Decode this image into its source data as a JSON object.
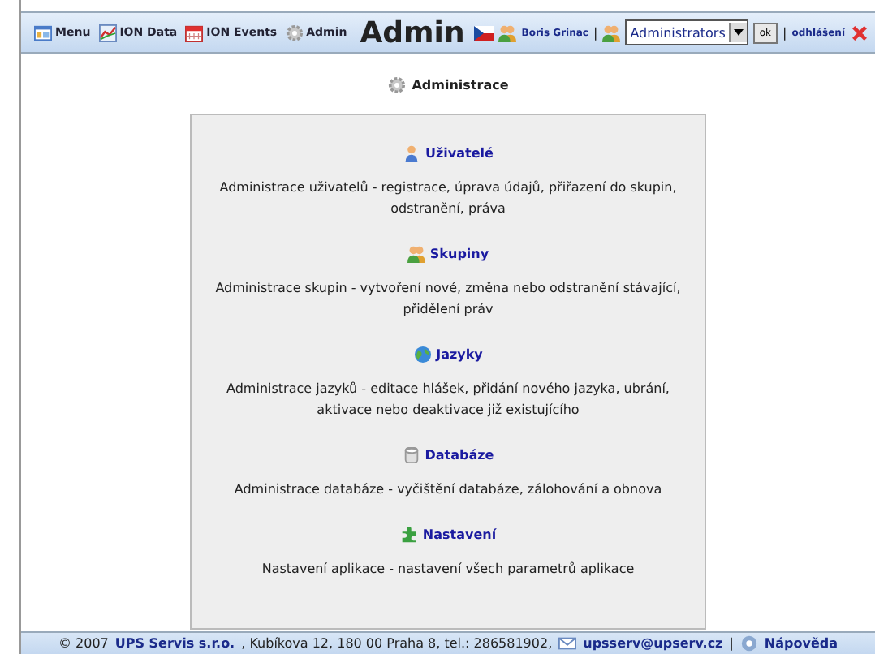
{
  "toolbar": {
    "nav": [
      {
        "kind": "menu",
        "label": "Menu"
      },
      {
        "kind": "data",
        "label": "ION Data"
      },
      {
        "kind": "events",
        "label": "ION Events"
      },
      {
        "kind": "admin",
        "label": "Admin"
      }
    ],
    "title": "Admin",
    "user": "Boris Grinac",
    "separator": "|",
    "role_select": {
      "value": "Administrators"
    },
    "ok_button": "ok",
    "separator_2": "|",
    "logout": "odhlášení"
  },
  "heading": "Administrace",
  "sections": [
    {
      "kind": "users",
      "title": "Uživatelé",
      "description": "Administrace uživatelů - registrace, úprava údajů, přiřazení do skupin, odstranění, práva"
    },
    {
      "kind": "groups",
      "title": "Skupiny",
      "description": "Administrace skupin - vytvoření nové, změna nebo odstranění stávající, přidělení práv"
    },
    {
      "kind": "languages",
      "title": "Jazyky",
      "description": "Administrace jazyků - editace hlášek, přidání nového jazyka, ubrání, aktivace nebo deaktivace již existujícího"
    },
    {
      "kind": "database",
      "title": "Databáze",
      "description": "Administrace databáze - vyčištění databáze, zálohování a obnova"
    },
    {
      "kind": "settings",
      "title": "Nastavení",
      "description": "Nastavení aplikace - nastavení všech parametrů aplikace"
    }
  ],
  "footer": {
    "copyright": "© 2007",
    "company": "UPS Servis s.r.o.",
    "address": ", Kubíkova 12, 180 00 Praha 8, tel.: 286581902,",
    "email": "upsserv@upserv.cz",
    "separator": "|",
    "help": "Nápověda"
  }
}
